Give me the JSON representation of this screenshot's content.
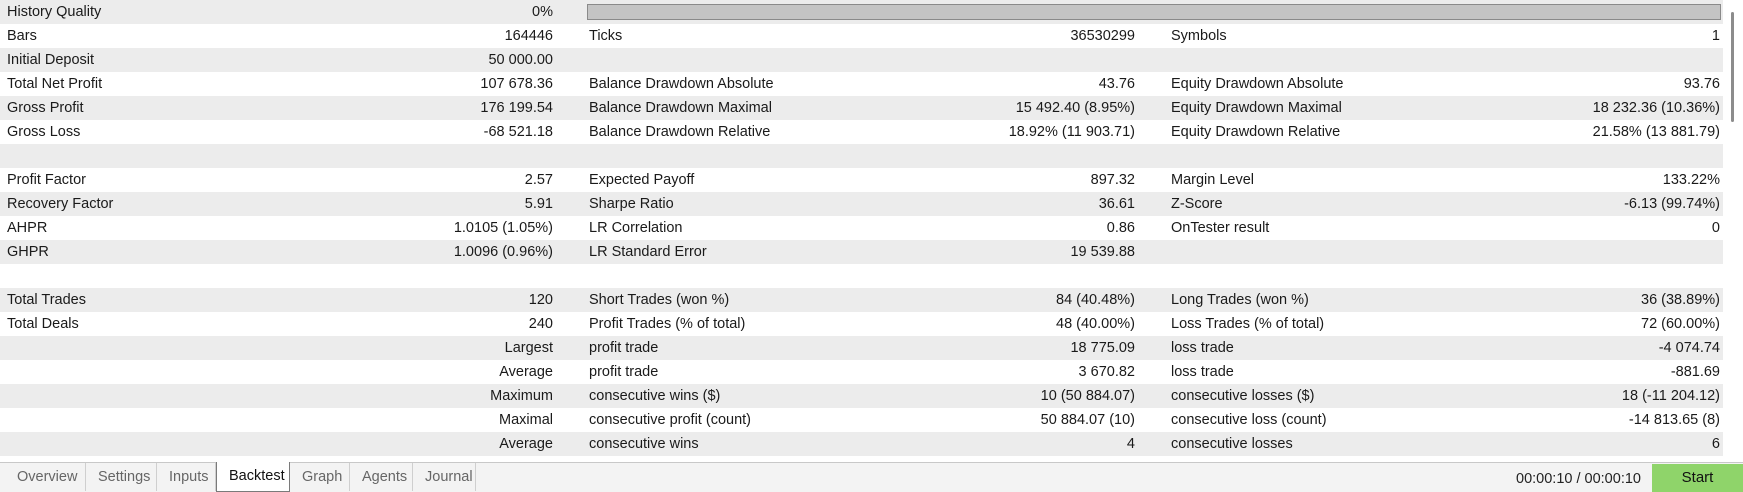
{
  "history_quality": {
    "label": "History Quality",
    "value": "0%",
    "level": 0
  },
  "rows": [
    {
      "c1": [
        "Bars",
        "164446"
      ],
      "c2": [
        "Ticks",
        "36530299"
      ],
      "c3": [
        "Symbols",
        "1"
      ]
    },
    {
      "c1": [
        "Initial Deposit",
        "50 000.00"
      ],
      "c2": [
        "",
        ""
      ],
      "c3": [
        "",
        ""
      ]
    },
    {
      "c1": [
        "Total Net Profit",
        "107 678.36"
      ],
      "c2": [
        "Balance Drawdown Absolute",
        "43.76"
      ],
      "c3": [
        "Equity Drawdown Absolute",
        "93.76"
      ]
    },
    {
      "c1": [
        "Gross Profit",
        "176 199.54"
      ],
      "c2": [
        "Balance Drawdown Maximal",
        "15 492.40 (8.95%)"
      ],
      "c3": [
        "Equity Drawdown Maximal",
        "18 232.36 (10.36%)"
      ]
    },
    {
      "c1": [
        "Gross Loss",
        "-68 521.18"
      ],
      "c2": [
        "Balance Drawdown Relative",
        "18.92% (11 903.71)"
      ],
      "c3": [
        "Equity Drawdown Relative",
        "21.58% (13 881.79)"
      ]
    },
    {
      "c1": [
        "",
        ""
      ],
      "c2": [
        "",
        ""
      ],
      "c3": [
        "",
        ""
      ]
    },
    {
      "c1": [
        "Profit Factor",
        "2.57"
      ],
      "c2": [
        "Expected Payoff",
        "897.32"
      ],
      "c3": [
        "Margin Level",
        "133.22%"
      ]
    },
    {
      "c1": [
        "Recovery Factor",
        "5.91"
      ],
      "c2": [
        "Sharpe Ratio",
        "36.61"
      ],
      "c3": [
        "Z-Score",
        "-6.13 (99.74%)"
      ]
    },
    {
      "c1": [
        "AHPR",
        "1.0105 (1.05%)"
      ],
      "c2": [
        "LR Correlation",
        "0.86"
      ],
      "c3": [
        "OnTester result",
        "0"
      ]
    },
    {
      "c1": [
        "GHPR",
        "1.0096 (0.96%)"
      ],
      "c2": [
        "LR Standard Error",
        "19 539.88"
      ],
      "c3": [
        "",
        ""
      ]
    },
    {
      "c1": [
        "",
        ""
      ],
      "c2": [
        "",
        ""
      ],
      "c3": [
        "",
        ""
      ]
    },
    {
      "c1": [
        "Total Trades",
        "120"
      ],
      "c2": [
        "Short Trades (won %)",
        "84 (40.48%)"
      ],
      "c3": [
        "Long Trades (won %)",
        "36 (38.89%)"
      ]
    },
    {
      "c1": [
        "Total Deals",
        "240"
      ],
      "c2": [
        "Profit Trades (% of total)",
        "48 (40.00%)"
      ],
      "c3": [
        "Loss Trades (% of total)",
        "72 (60.00%)"
      ]
    },
    {
      "c1": [
        "",
        "Largest"
      ],
      "c2": [
        "profit trade",
        "18 775.09"
      ],
      "c3": [
        "loss trade",
        "-4 074.74"
      ]
    },
    {
      "c1": [
        "",
        "Average"
      ],
      "c2": [
        "profit trade",
        "3 670.82"
      ],
      "c3": [
        "loss trade",
        "-881.69"
      ]
    },
    {
      "c1": [
        "",
        "Maximum"
      ],
      "c2": [
        "consecutive wins ($)",
        "10 (50 884.07)"
      ],
      "c3": [
        "consecutive losses ($)",
        "18 (-11 204.12)"
      ]
    },
    {
      "c1": [
        "",
        "Maximal"
      ],
      "c2": [
        "consecutive profit (count)",
        "50 884.07 (10)"
      ],
      "c3": [
        "consecutive loss (count)",
        "-14 813.65 (8)"
      ]
    },
    {
      "c1": [
        "",
        "Average"
      ],
      "c2": [
        "consecutive wins",
        "4"
      ],
      "c3": [
        "consecutive losses",
        "6"
      ]
    }
  ],
  "tabs": [
    {
      "label": "Overview",
      "active": false
    },
    {
      "label": "Settings",
      "active": false
    },
    {
      "label": "Inputs",
      "active": false
    },
    {
      "label": "Backtest",
      "active": true
    },
    {
      "label": "Graph",
      "active": false
    },
    {
      "label": "Agents",
      "active": false
    },
    {
      "label": "Journal",
      "active": false
    }
  ],
  "timer": "00:00:10 / 00:00:10",
  "start_label": "Start",
  "colors": {
    "start_button": "#8fd46a",
    "row_alt": "#ececec",
    "history_bar": "#c4c4c4"
  }
}
